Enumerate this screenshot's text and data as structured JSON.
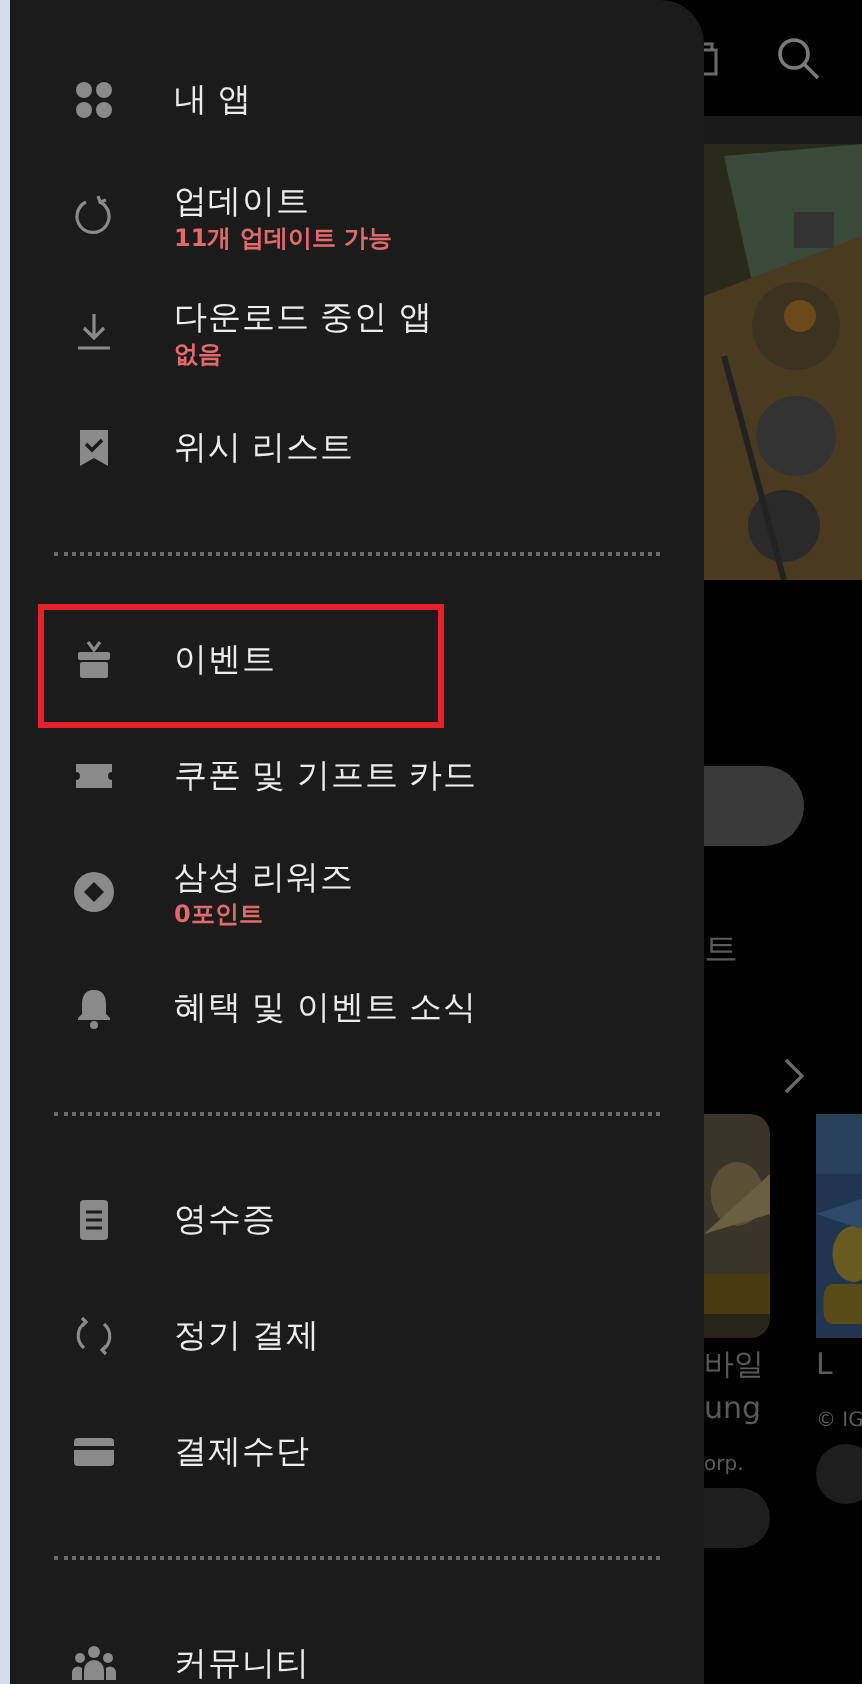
{
  "drawer": {
    "sections": [
      {
        "items": [
          {
            "title": "내 앱",
            "highlighted": false
          },
          {
            "title": "업데이트",
            "subtitle": "11개 업데이트 가능",
            "highlighted": false
          },
          {
            "title": "다운로드 중인 앱",
            "subtitle": "없음",
            "highlighted": false
          },
          {
            "title": "위시 리스트",
            "highlighted": false
          }
        ]
      },
      {
        "items": [
          {
            "title": "이벤트",
            "highlighted": true
          },
          {
            "title": "쿠폰 및 기프트 카드",
            "highlighted": false
          },
          {
            "title": "삼성 리워즈",
            "subtitle": "0포인트",
            "highlighted": false
          },
          {
            "title": "혜택 및 이벤트 소식",
            "highlighted": false
          }
        ]
      },
      {
        "items": [
          {
            "title": "영수증",
            "highlighted": false
          },
          {
            "title": "정기 결제",
            "highlighted": false
          },
          {
            "title": "결제수단",
            "highlighted": false
          }
        ]
      },
      {
        "items": [
          {
            "title": "커뮤니티",
            "highlighted": false
          }
        ]
      }
    ]
  },
  "background_page": {
    "section_heading": "트",
    "cards": [
      {
        "title_lines": [
          "바일",
          "ung"
        ],
        "publisher": "orp."
      },
      {
        "title_lines": [
          "L"
        ],
        "publisher": "© IG"
      }
    ]
  }
}
